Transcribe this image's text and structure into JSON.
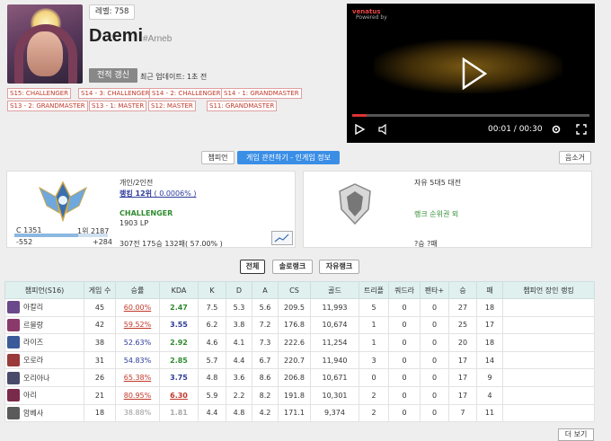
{
  "profile": {
    "level": "레벨: 758",
    "name": "Daemi",
    "tag": "#Arneb",
    "refresh_label": "전적 갱신",
    "updated": "최근 업데이트: 1초 전"
  },
  "badges": [
    "S15: CHALLENGER",
    "S14 - 3: CHALLENGER",
    "S14 - 2: CHALLENGER",
    "S14 - 1: GRANDMASTER",
    "S13 - 2: GRANDMASTER",
    "S13 - 1: MASTER",
    "S12: MASTER",
    "S11: GRANDMASTER"
  ],
  "video": {
    "watermark": "venatus",
    "watermark_sub": "Powered by",
    "time": "00:01 / 00:30",
    "progress": 0.06
  },
  "tabs": {
    "champion": "챔피언",
    "ingame": "게임 관전하기 - 인게임 정보",
    "summon": "음소거"
  },
  "solo": {
    "queue": "개인/2인전",
    "rank": "랭킹 12위",
    "rank_pct": "( 0.0006% )",
    "tier": "CHALLENGER",
    "lp": "1903 LP",
    "record": "307전 175승 132패( 57.00% )",
    "c_label": "C 1351",
    "top_label": "1위 2187",
    "minus": "-552",
    "plus": "+284",
    "progress": 0.68
  },
  "flex": {
    "queue": "자유 5대5 대전",
    "rank_text": "랭크 순위권 외",
    "record": "?승 ?패"
  },
  "filters": [
    "전체",
    "솔로랭크",
    "자유랭크"
  ],
  "table": {
    "headers": [
      "챔피언(S16)",
      "게임 수",
      "승률",
      "KDA",
      "K",
      "D",
      "A",
      "CS",
      "골드",
      "트리플",
      "쿼드라",
      "펜타+",
      "승",
      "패",
      "챔피언 장인 랭킹"
    ],
    "rows": [
      {
        "champ": "아칼리",
        "games": "45",
        "wr": "60.00%",
        "kda": "2.47",
        "k": "7.5",
        "d": "5.3",
        "a": "5.6",
        "cs": "209.5",
        "gold": "11,993",
        "triple": "5",
        "quadra": "0",
        "penta": "0",
        "w": "27",
        "l": "18",
        "wrc": "#c0392b",
        "kdac": "#2e8b2e",
        "icon": "#6a4a8a"
      },
      {
        "champ": "르블랑",
        "games": "42",
        "wr": "59.52%",
        "kda": "3.55",
        "k": "6.2",
        "d": "3.8",
        "a": "7.2",
        "cs": "176.8",
        "gold": "10,674",
        "triple": "1",
        "quadra": "0",
        "penta": "0",
        "w": "25",
        "l": "17",
        "wrc": "#c0392b",
        "kdac": "#2b3a9a",
        "icon": "#8a3a6a"
      },
      {
        "champ": "라이즈",
        "games": "38",
        "wr": "52.63%",
        "kda": "2.92",
        "k": "4.6",
        "d": "4.1",
        "a": "7.3",
        "cs": "222.6",
        "gold": "11,254",
        "triple": "1",
        "quadra": "0",
        "penta": "0",
        "w": "20",
        "l": "18",
        "wrc": "#2b3a9a",
        "kdac": "#2e8b2e",
        "icon": "#3a5a9a"
      },
      {
        "champ": "오로라",
        "games": "31",
        "wr": "54.83%",
        "kda": "2.85",
        "k": "5.7",
        "d": "4.4",
        "a": "6.7",
        "cs": "220.7",
        "gold": "11,940",
        "triple": "3",
        "quadra": "0",
        "penta": "0",
        "w": "17",
        "l": "14",
        "wrc": "#2b3a9a",
        "kdac": "#2e8b2e",
        "icon": "#9a3a3a"
      },
      {
        "champ": "오리아나",
        "games": "26",
        "wr": "65.38%",
        "kda": "3.75",
        "k": "4.8",
        "d": "3.6",
        "a": "8.6",
        "cs": "206.8",
        "gold": "10,671",
        "triple": "0",
        "quadra": "0",
        "penta": "0",
        "w": "17",
        "l": "9",
        "wrc": "#c0392b",
        "kdac": "#2b3a9a",
        "icon": "#4a4a6a"
      },
      {
        "champ": "아리",
        "games": "21",
        "wr": "80.95%",
        "kda": "6.30",
        "k": "5.9",
        "d": "2.2",
        "a": "8.2",
        "cs": "191.8",
        "gold": "10,301",
        "triple": "2",
        "quadra": "0",
        "penta": "0",
        "w": "17",
        "l": "4",
        "wrc": "#c0392b",
        "kdac": "#c0392b",
        "icon": "#7a2a4a"
      },
      {
        "champ": "암베사",
        "games": "18",
        "wr": "38.88%",
        "kda": "1.81",
        "k": "4.4",
        "d": "4.8",
        "a": "4.2",
        "cs": "171.1",
        "gold": "9,374",
        "triple": "2",
        "quadra": "0",
        "penta": "0",
        "w": "7",
        "l": "11",
        "wrc": "#999999",
        "kdac": "#aaaaaa",
        "icon": "#5a5a5a"
      }
    ]
  },
  "more_label": "더 보기"
}
